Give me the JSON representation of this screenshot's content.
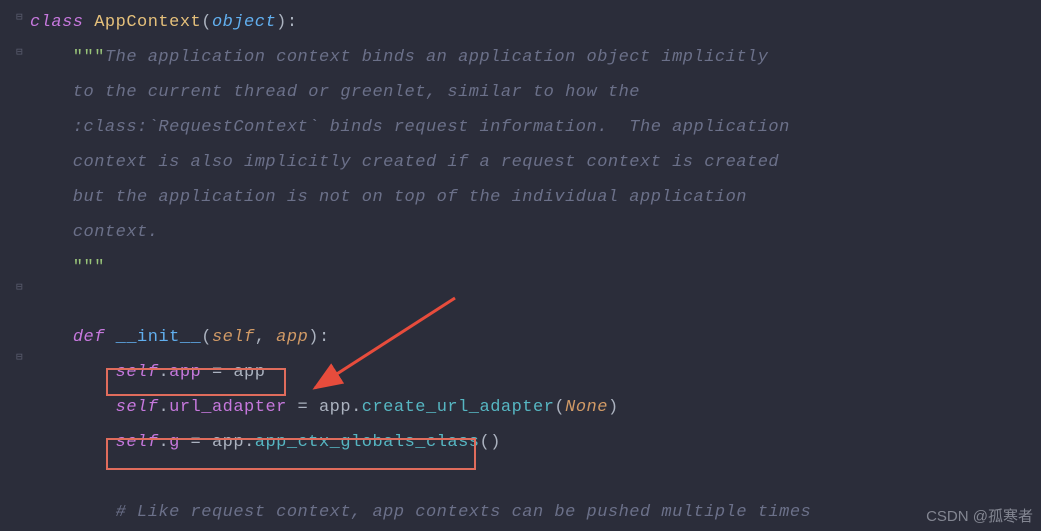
{
  "code": {
    "line1": {
      "kw": "class ",
      "name": "AppContext",
      "paren_open": "(",
      "base": "object",
      "paren_close": "):"
    },
    "docstring": {
      "open": "    \"\"\"",
      "l1": "The application context binds an application object implicitly",
      "l2": "    to the current thread or greenlet, similar to how the",
      "l3": "    :class:`RequestContext` binds request information.  The application",
      "l4": "    context is also implicitly created if a request context is created",
      "l5": "    but the application is not on top of the individual application",
      "l6": "    context.",
      "close": "    \"\"\""
    },
    "init": {
      "indent": "    ",
      "kw": "def ",
      "name": "__init__",
      "paren_open": "(",
      "p1": "self",
      "comma": ", ",
      "p2": "app",
      "paren_close": "):"
    },
    "body": {
      "l1_indent": "        ",
      "l1_self": "self",
      "l1_dot": ".",
      "l1_attr": "app",
      "l1_eq": " = ",
      "l1_val": "app",
      "l2_indent": "        ",
      "l2_self": "self",
      "l2_dot": ".",
      "l2_attr": "url_adapter",
      "l2_eq": " = ",
      "l2_obj": "app",
      "l2_dot2": ".",
      "l2_method": "create_url_adapter",
      "l2_popen": "(",
      "l2_arg": "None",
      "l2_pclose": ")",
      "l3_indent": "        ",
      "l3_self": "self",
      "l3_dot": ".",
      "l3_attr": "g",
      "l3_eq": " = ",
      "l3_obj": "app",
      "l3_dot2": ".",
      "l3_method": "app_ctx_globals_class",
      "l3_parens": "()"
    },
    "comment": {
      "indent": "        ",
      "text": "# Like request context, app contexts can be pushed multiple times"
    }
  },
  "watermark": "CSDN @孤寒者"
}
